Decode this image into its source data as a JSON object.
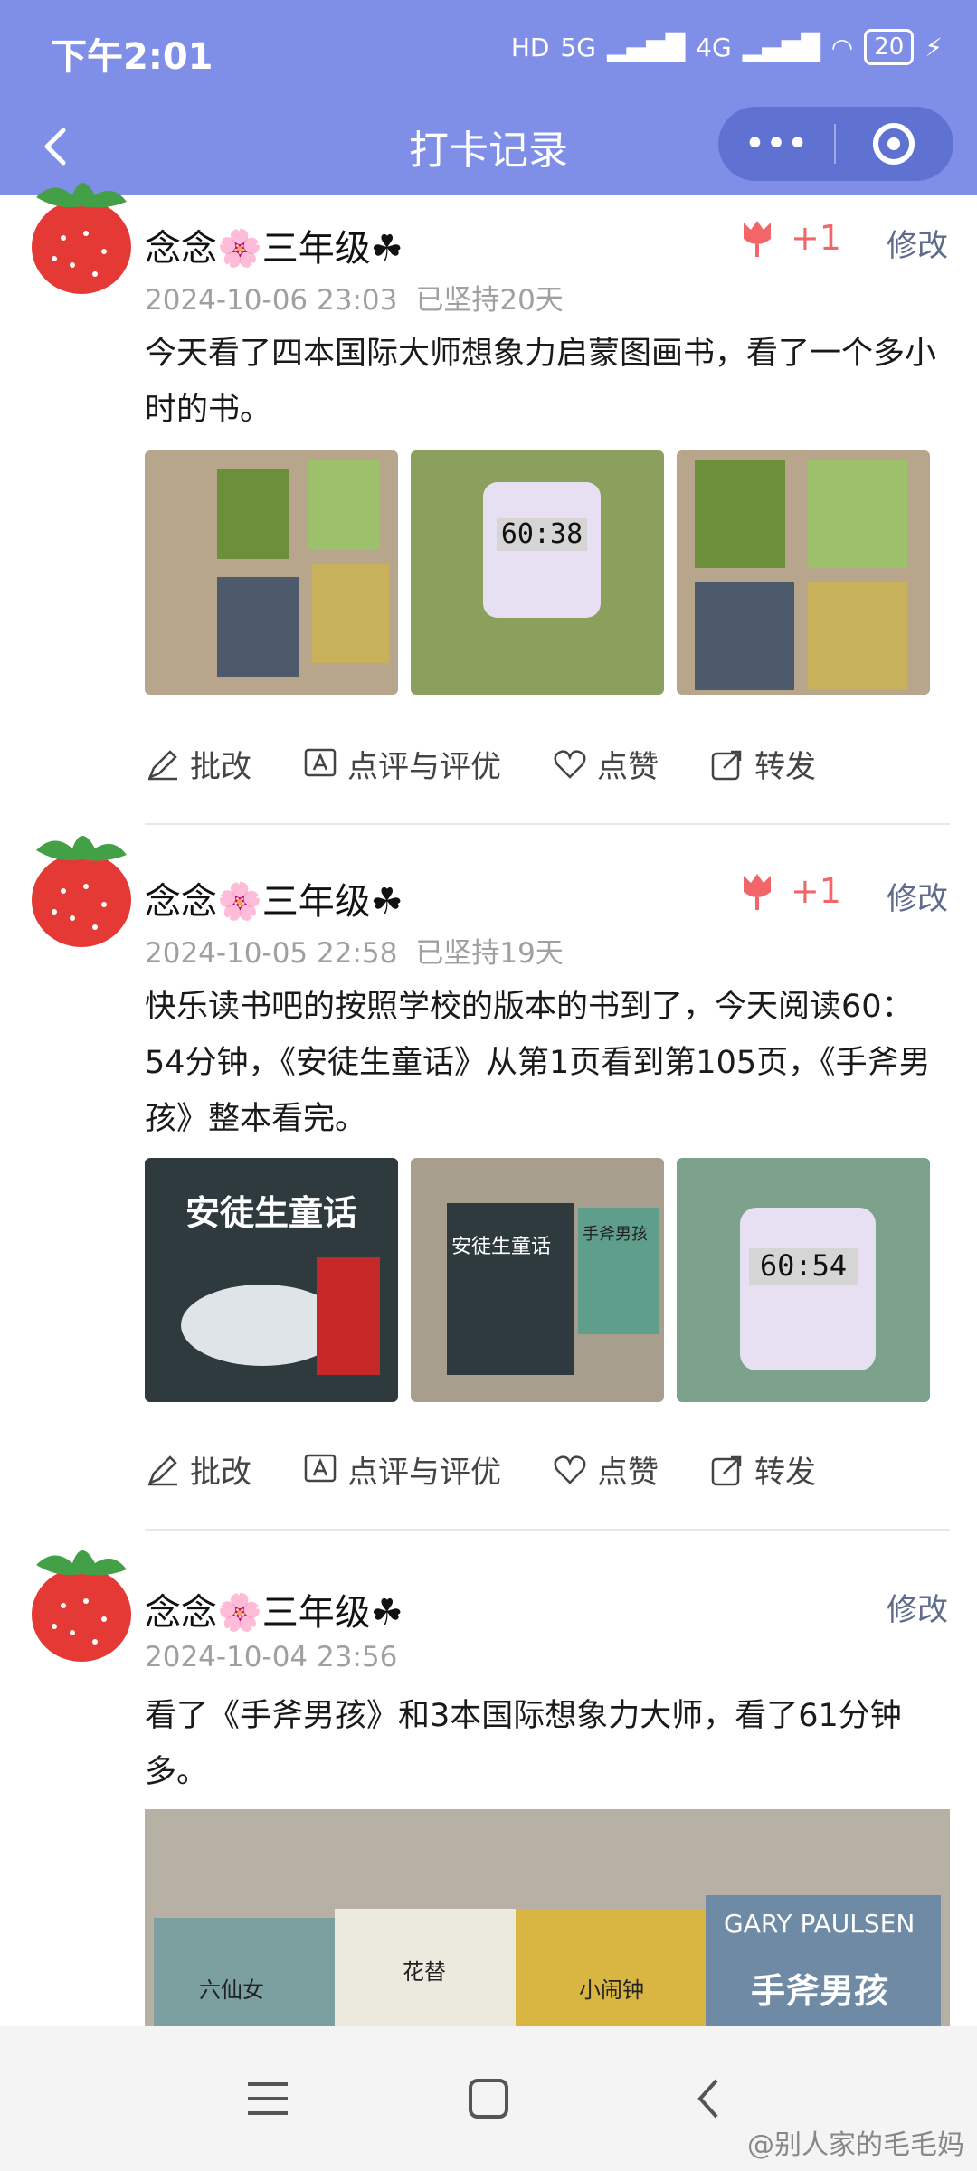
{
  "status": {
    "time": "下午2:01",
    "signal1": "5G",
    "signal2": "4G",
    "hd": "HD",
    "battery": "20"
  },
  "nav": {
    "title": "打卡记录",
    "more": "•••"
  },
  "posts": [
    {
      "name": "念念🌸三年级☘",
      "date": "2024-10-06 23:03",
      "days": "已坚持20天",
      "likes": "+1",
      "edit": "修改",
      "text": "今天看了四本国际大师想象力启蒙图画书，看了一个多小时的书。",
      "timer": "60:38",
      "actions": [
        "批改",
        "点评与评优",
        "点赞",
        "转发"
      ]
    },
    {
      "name": "念念🌸三年级☘",
      "date": "2024-10-05 22:58",
      "days": "已坚持19天",
      "likes": "+1",
      "edit": "修改",
      "text": "快乐读书吧的按照学校的版本的书到了，今天阅读60：54分钟，《安徒生童话》从第1页看到第105页，《手斧男孩》整本看完。",
      "book1": "安徒生童话",
      "book2": "手斧男孩",
      "timer": "60:54",
      "actions": [
        "批改",
        "点评与评优",
        "点赞",
        "转发"
      ]
    },
    {
      "name": "念念🌸三年级☘",
      "date": "2024-10-04 23:56",
      "edit": "修改",
      "text": "看了《手斧男孩》和3本国际想象力大师，看了61分钟多。",
      "book_labels": [
        "六仙女",
        "花替",
        "小闹钟",
        "手斧男孩"
      ],
      "cover_author": "GARY PAULSEN"
    }
  ],
  "watermark": "@别人家的毛毛妈",
  "colors": {
    "header": "#7f8fe8",
    "capsule": "#5f72d2",
    "like": "#f2666a"
  }
}
